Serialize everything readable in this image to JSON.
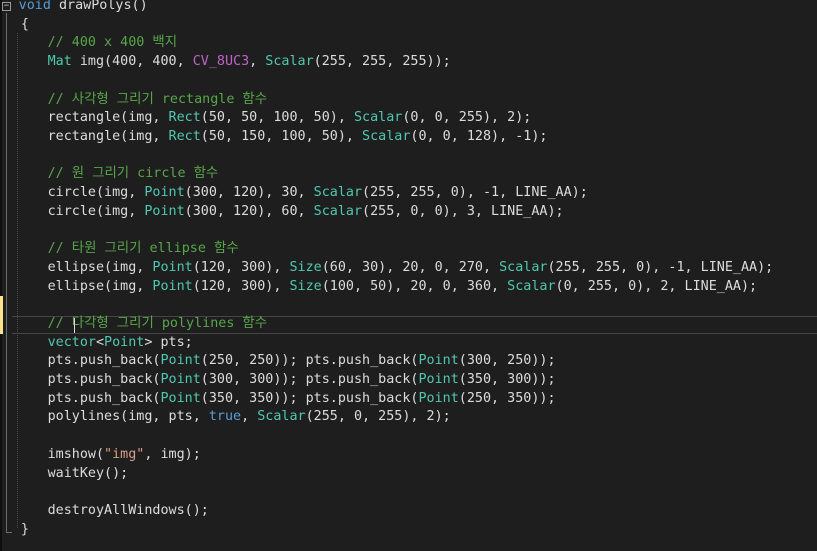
{
  "editor": {
    "fold_icon": "minus",
    "lines": [
      {
        "row": 0,
        "indent": 0.75,
        "segments": [
          {
            "t": "void",
            "c": "keyword"
          },
          {
            "t": " drawPolys()",
            "c": "default"
          }
        ]
      },
      {
        "row": 1,
        "indent": 1,
        "segments": [
          {
            "t": "{",
            "c": "default"
          }
        ]
      },
      {
        "row": 2,
        "indent": 4,
        "segments": [
          {
            "t": "// 400 x 400 백지",
            "c": "comment"
          }
        ]
      },
      {
        "row": 3,
        "indent": 4,
        "segments": [
          {
            "t": "Mat",
            "c": "type"
          },
          {
            "t": " img(400, 400, ",
            "c": "default"
          },
          {
            "t": "CV_8UC3",
            "c": "macro"
          },
          {
            "t": ", ",
            "c": "default"
          },
          {
            "t": "Scalar",
            "c": "type"
          },
          {
            "t": "(255, 255, 255));",
            "c": "default"
          }
        ]
      },
      {
        "row": 5,
        "indent": 4,
        "segments": [
          {
            "t": "// 사각형 그리기 rectangle 함수",
            "c": "comment"
          }
        ]
      },
      {
        "row": 6,
        "indent": 4,
        "segments": [
          {
            "t": "rectangle(img, ",
            "c": "default"
          },
          {
            "t": "Rect",
            "c": "type"
          },
          {
            "t": "(50, 50, 100, 50), ",
            "c": "default"
          },
          {
            "t": "Scalar",
            "c": "type"
          },
          {
            "t": "(0, 0, 255), 2);",
            "c": "default"
          }
        ]
      },
      {
        "row": 7,
        "indent": 4,
        "segments": [
          {
            "t": "rectangle(img, ",
            "c": "default"
          },
          {
            "t": "Rect",
            "c": "type"
          },
          {
            "t": "(50, 150, 100, 50), ",
            "c": "default"
          },
          {
            "t": "Scalar",
            "c": "type"
          },
          {
            "t": "(0, 0, 128), -1);",
            "c": "default"
          }
        ]
      },
      {
        "row": 9,
        "indent": 4,
        "segments": [
          {
            "t": "// 원 그리기 circle 함수",
            "c": "comment"
          }
        ]
      },
      {
        "row": 10,
        "indent": 4,
        "segments": [
          {
            "t": "circle(img, ",
            "c": "default"
          },
          {
            "t": "Point",
            "c": "type"
          },
          {
            "t": "(300, 120), 30, ",
            "c": "default"
          },
          {
            "t": "Scalar",
            "c": "type"
          },
          {
            "t": "(255, 255, 0), -1, LINE_AA);",
            "c": "default"
          }
        ]
      },
      {
        "row": 11,
        "indent": 4,
        "segments": [
          {
            "t": "circle(img, ",
            "c": "default"
          },
          {
            "t": "Point",
            "c": "type"
          },
          {
            "t": "(300, 120), 60, ",
            "c": "default"
          },
          {
            "t": "Scalar",
            "c": "type"
          },
          {
            "t": "(255, 0, 0), 3, LINE_AA);",
            "c": "default"
          }
        ]
      },
      {
        "row": 13,
        "indent": 4,
        "segments": [
          {
            "t": "// 타원 그리기 ellipse 함수",
            "c": "comment"
          }
        ]
      },
      {
        "row": 14,
        "indent": 4,
        "segments": [
          {
            "t": "ellipse(img, ",
            "c": "default"
          },
          {
            "t": "Point",
            "c": "type"
          },
          {
            "t": "(120, 300), ",
            "c": "default"
          },
          {
            "t": "Size",
            "c": "type"
          },
          {
            "t": "(60, 30), 20, 0, 270, ",
            "c": "default"
          },
          {
            "t": "Scalar",
            "c": "type"
          },
          {
            "t": "(255, 255, 0), -1, LINE_AA);",
            "c": "default"
          }
        ]
      },
      {
        "row": 15,
        "indent": 4,
        "segments": [
          {
            "t": "ellipse(img, ",
            "c": "default"
          },
          {
            "t": "Point",
            "c": "type"
          },
          {
            "t": "(120, 300), ",
            "c": "default"
          },
          {
            "t": "Size",
            "c": "type"
          },
          {
            "t": "(100, 50), 20, 0, 360, ",
            "c": "default"
          },
          {
            "t": "Scalar",
            "c": "type"
          },
          {
            "t": "(0, 255, 0), 2, LINE_AA);",
            "c": "default"
          }
        ]
      },
      {
        "row": 17,
        "indent": 4,
        "segments": [
          {
            "t": "// 다각형 그리기 polylines 함수",
            "c": "comment"
          }
        ]
      },
      {
        "row": 18,
        "indent": 4,
        "segments": [
          {
            "t": "vector",
            "c": "type"
          },
          {
            "t": "<",
            "c": "default"
          },
          {
            "t": "Point",
            "c": "type"
          },
          {
            "t": "> pts;",
            "c": "default"
          }
        ]
      },
      {
        "row": 19,
        "indent": 4,
        "segments": [
          {
            "t": "pts.push_back(",
            "c": "default"
          },
          {
            "t": "Point",
            "c": "type"
          },
          {
            "t": "(250, 250)); pts.push_back(",
            "c": "default"
          },
          {
            "t": "Point",
            "c": "type"
          },
          {
            "t": "(300, 250));",
            "c": "default"
          }
        ]
      },
      {
        "row": 20,
        "indent": 4,
        "segments": [
          {
            "t": "pts.push_back(",
            "c": "default"
          },
          {
            "t": "Point",
            "c": "type"
          },
          {
            "t": "(300, 300)); pts.push_back(",
            "c": "default"
          },
          {
            "t": "Point",
            "c": "type"
          },
          {
            "t": "(350, 300));",
            "c": "default"
          }
        ]
      },
      {
        "row": 21,
        "indent": 4,
        "segments": [
          {
            "t": "pts.push_back(",
            "c": "default"
          },
          {
            "t": "Point",
            "c": "type"
          },
          {
            "t": "(350, 350)); pts.push_back(",
            "c": "default"
          },
          {
            "t": "Point",
            "c": "type"
          },
          {
            "t": "(250, 350));",
            "c": "default"
          }
        ]
      },
      {
        "row": 22,
        "indent": 4,
        "segments": [
          {
            "t": "polylines(img, pts, ",
            "c": "default"
          },
          {
            "t": "true",
            "c": "keyword"
          },
          {
            "t": ", ",
            "c": "default"
          },
          {
            "t": "Scalar",
            "c": "type"
          },
          {
            "t": "(255, 0, 255), 2);",
            "c": "default"
          }
        ]
      },
      {
        "row": 24,
        "indent": 4,
        "segments": [
          {
            "t": "imshow(",
            "c": "default"
          },
          {
            "t": "\"img\"",
            "c": "string"
          },
          {
            "t": ", img);",
            "c": "default"
          }
        ]
      },
      {
        "row": 25,
        "indent": 4,
        "segments": [
          {
            "t": "waitKey();",
            "c": "default"
          }
        ]
      },
      {
        "row": 27,
        "indent": 4,
        "segments": [
          {
            "t": "destroyAllWindows();",
            "c": "default"
          }
        ]
      },
      {
        "row": 28,
        "indent": 1,
        "segments": [
          {
            "t": "}",
            "c": "default"
          }
        ]
      }
    ]
  }
}
